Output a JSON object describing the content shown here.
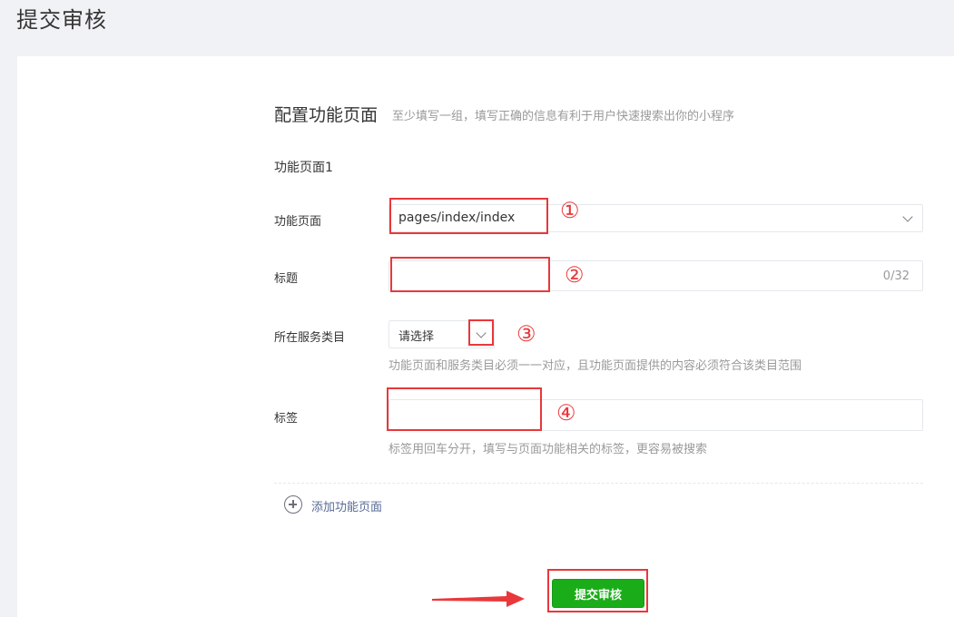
{
  "page": {
    "title": "提交审核"
  },
  "section": {
    "title": "配置功能页面",
    "tip": "至少填写一组，填写正确的信息有利于用户快速搜索出你的小程序"
  },
  "group": {
    "title": "功能页面1",
    "fields": {
      "page": {
        "label": "功能页面",
        "value": "pages/index/index"
      },
      "title": {
        "label": "标题",
        "value": "",
        "counter": "0/32"
      },
      "category": {
        "label": "所在服务类目",
        "value": "请选择",
        "hint": "功能页面和服务类目必须一一对应，且功能页面提供的内容必须符合该类目范围"
      },
      "tags": {
        "label": "标签",
        "value": "",
        "hint": "标签用回车分开，填写与页面功能相关的标签，更容易被搜索"
      }
    }
  },
  "add_page": {
    "label": "添加功能页面"
  },
  "submit": {
    "label": "提交审核"
  },
  "annotations": {
    "markers": [
      "①",
      "②",
      "③",
      "④"
    ],
    "color": "#e9383b"
  },
  "colors": {
    "accent_green": "#1aad19",
    "link_blue": "#576b95",
    "background": "#f1f2f5"
  },
  "icons": {
    "dropdown": "chevron-down-icon",
    "add": "plus-circle-icon",
    "arrow": "arrow-right-icon"
  }
}
